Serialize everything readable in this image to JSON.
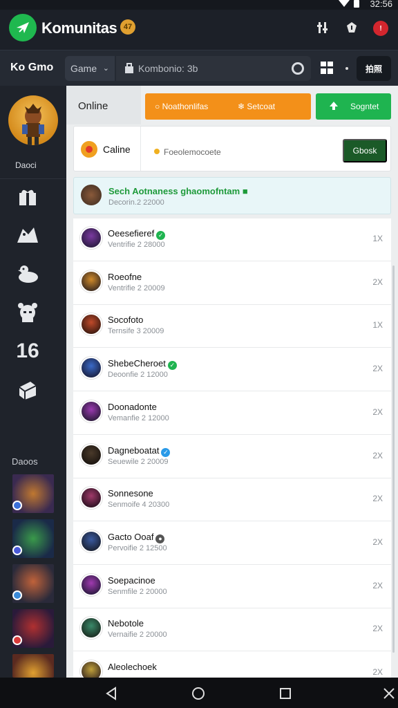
{
  "status_bar": {
    "clock": "32:56"
  },
  "app": {
    "title": "Komunitas",
    "badge": "47"
  },
  "toolbar": {
    "brand": "Ko Gmo",
    "game_select": "Game",
    "search_value": "Kombonio: 3b",
    "qr_label": "拍照"
  },
  "sidebar": {
    "hero_name": "Daoci",
    "icons": [
      "gift-icon",
      "bird-icon",
      "duck-icon",
      "monster-icon",
      "sixteen-icon",
      "cube-icon"
    ],
    "icon_16_text": "16",
    "section_label": "Daoos"
  },
  "main": {
    "online_tab": "Online",
    "orange_button": {
      "label1": "Noathonlifas",
      "label2": "Setcoat"
    },
    "green_button": {
      "label": "Sogntet"
    },
    "status": {
      "name": "Caline",
      "note": "Foeolemocoete",
      "button": "Gbosk"
    },
    "featured": {
      "title": "Sech Aotnaness ghaomofntam",
      "subtitle": "Decorin.2 22000"
    },
    "rows": [
      {
        "name": "Oeesefieref",
        "sub": "Ventrifie 2 28000",
        "count": "1X",
        "badge": "green"
      },
      {
        "name": "Roeofne",
        "sub": "Ventrifie 2 20009",
        "count": "2X",
        "badge": ""
      },
      {
        "name": "Socofoto",
        "sub": "Ternsife 3 20009",
        "count": "1X",
        "badge": ""
      },
      {
        "name": "ShebeCheroet",
        "sub": "Deoonfie 2 12000",
        "count": "2X",
        "badge": "green"
      },
      {
        "name": "Doonadonte",
        "sub": "Vemanfie 2 12000",
        "count": "2X",
        "badge": ""
      },
      {
        "name": "Dagneboatat",
        "sub": "Seuewile 2 20009",
        "count": "2X",
        "badge": "blue"
      },
      {
        "name": "Sonnesone",
        "sub": "Senmoife 4 20300",
        "count": "2X",
        "badge": ""
      },
      {
        "name": "Gacto Ooaf",
        "sub": "Pervoifie 2 12500",
        "count": "2X",
        "badge": "gray"
      },
      {
        "name": "Soepacinoe",
        "sub": "Senmfile 2 20000",
        "count": "2X",
        "badge": ""
      },
      {
        "name": "Nebotole",
        "sub": "Vernaifie 2 20000",
        "count": "2X",
        "badge": ""
      },
      {
        "name": "Aleolechoek",
        "sub": "",
        "count": "2X",
        "badge": ""
      }
    ]
  },
  "colors": {
    "accent_green": "#1fb450",
    "accent_orange": "#f39019",
    "dark_bg": "#1c2028"
  }
}
